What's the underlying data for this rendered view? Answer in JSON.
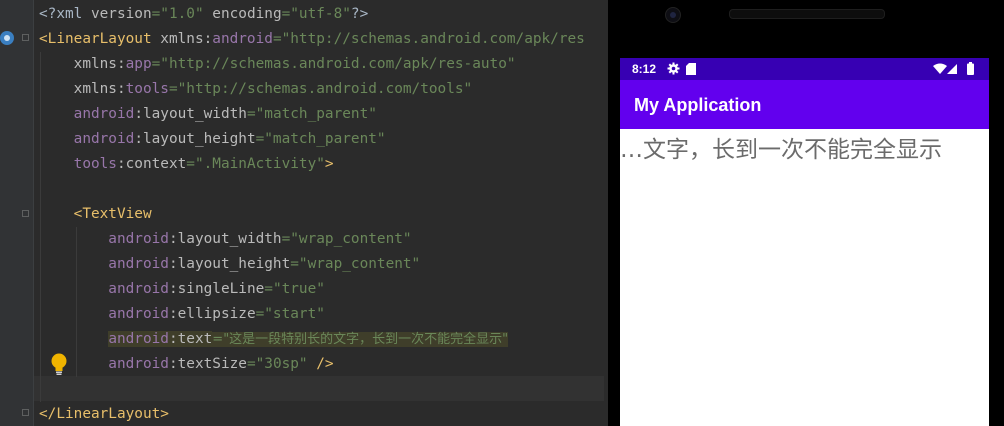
{
  "editor": {
    "lines": [
      {
        "tokens": [
          {
            "t": "<?xml ",
            "c": "plain"
          },
          {
            "t": "version",
            "c": "attr"
          },
          {
            "t": "=\"1.0\" ",
            "c": "val"
          },
          {
            "t": "encoding",
            "c": "attr"
          },
          {
            "t": "=\"utf-8\"",
            "c": "val"
          },
          {
            "t": "?>",
            "c": "plain"
          }
        ]
      },
      {
        "tokens": [
          {
            "t": "<LinearLayout ",
            "c": "tag"
          },
          {
            "t": "xmlns:",
            "c": "attr"
          },
          {
            "t": "android",
            "c": "attr-ns"
          },
          {
            "t": "=\"http://schemas.android.com/apk/res",
            "c": "val"
          }
        ]
      },
      {
        "tokens": [
          {
            "t": "    xmlns:",
            "c": "attr"
          },
          {
            "t": "app",
            "c": "attr-ns"
          },
          {
            "t": "=\"http://schemas.android.com/apk/res-auto\"",
            "c": "val"
          }
        ]
      },
      {
        "tokens": [
          {
            "t": "    xmlns:",
            "c": "attr"
          },
          {
            "t": "tools",
            "c": "attr-ns"
          },
          {
            "t": "=\"http://schemas.android.com/tools\"",
            "c": "val"
          }
        ]
      },
      {
        "tokens": [
          {
            "t": "    android",
            "c": "attr-ns"
          },
          {
            "t": ":layout_width",
            "c": "attr"
          },
          {
            "t": "=\"match_parent\"",
            "c": "val"
          }
        ]
      },
      {
        "tokens": [
          {
            "t": "    android",
            "c": "attr-ns"
          },
          {
            "t": ":layout_height",
            "c": "attr"
          },
          {
            "t": "=\"match_parent\"",
            "c": "val"
          }
        ]
      },
      {
        "tokens": [
          {
            "t": "    tools",
            "c": "attr-ns"
          },
          {
            "t": ":context",
            "c": "attr"
          },
          {
            "t": "=\".MainActivity\"",
            "c": "val"
          },
          {
            "t": ">",
            "c": "tag"
          }
        ]
      },
      {
        "tokens": []
      },
      {
        "tokens": [
          {
            "t": "    <TextView",
            "c": "tag"
          }
        ]
      },
      {
        "tokens": [
          {
            "t": "        android",
            "c": "attr-ns"
          },
          {
            "t": ":layout_width",
            "c": "attr"
          },
          {
            "t": "=\"wrap_content\"",
            "c": "val"
          }
        ]
      },
      {
        "tokens": [
          {
            "t": "        android",
            "c": "attr-ns"
          },
          {
            "t": ":layout_height",
            "c": "attr"
          },
          {
            "t": "=\"wrap_content\"",
            "c": "val"
          }
        ]
      },
      {
        "tokens": [
          {
            "t": "        android",
            "c": "attr-ns"
          },
          {
            "t": ":singleLine",
            "c": "attr"
          },
          {
            "t": "=\"true\"",
            "c": "val"
          }
        ]
      },
      {
        "tokens": [
          {
            "t": "        android",
            "c": "attr-ns"
          },
          {
            "t": ":ellipsize",
            "c": "attr"
          },
          {
            "t": "=\"start\"",
            "c": "val"
          }
        ]
      },
      {
        "tokens": [
          {
            "t": "        ",
            "c": "plain"
          },
          {
            "t": "android",
            "c": "attr-ns hl"
          },
          {
            "t": ":text",
            "c": "attr hl"
          },
          {
            "t": "=\"这是一段特别长的文字，长到一次不能完全显示\"",
            "c": "val hl cjk"
          }
        ]
      },
      {
        "tokens": [
          {
            "t": "        android",
            "c": "attr-ns"
          },
          {
            "t": ":textSize",
            "c": "attr"
          },
          {
            "t": "=\"30sp\" ",
            "c": "val"
          },
          {
            "t": "/>",
            "c": "tag"
          }
        ]
      },
      {
        "tokens": []
      },
      {
        "tokens": [
          {
            "t": "</LinearLayout>",
            "c": "tag"
          }
        ]
      }
    ]
  },
  "device": {
    "status_time": "8:12",
    "app_title": "My Application",
    "text_view": "…文字，长到一次不能完全显示"
  },
  "colors": {
    "status_bar": "#3700b3",
    "app_bar": "#6200ee",
    "editor_bg": "#2b2b2b"
  }
}
